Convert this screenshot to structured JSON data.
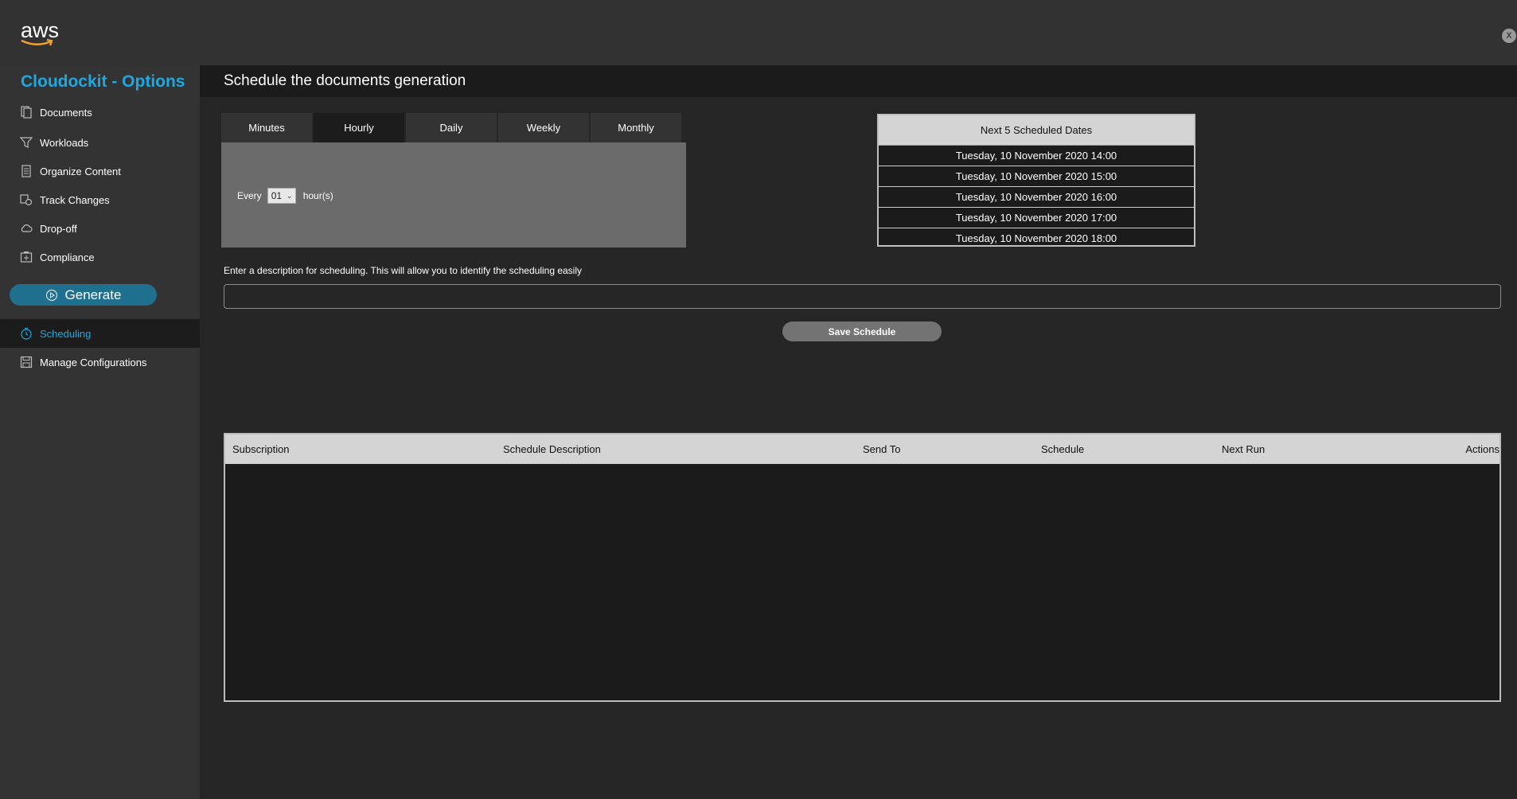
{
  "topbar": {
    "logo": "aws",
    "close_label": "x"
  },
  "sidebar": {
    "title": "Cloudockit - Options",
    "items": [
      {
        "label": "Documents",
        "icon": "documents-icon"
      },
      {
        "label": "Workloads",
        "icon": "filter-icon"
      },
      {
        "label": "Organize Content",
        "icon": "organize-icon"
      },
      {
        "label": "Track Changes",
        "icon": "track-changes-icon"
      },
      {
        "label": "Drop-off",
        "icon": "cloud-icon"
      },
      {
        "label": "Compliance",
        "icon": "compliance-icon"
      }
    ],
    "generate_label": "Generate",
    "bottom_items": [
      {
        "label": "Scheduling",
        "icon": "clock-icon",
        "active": true
      },
      {
        "label": "Manage Configurations",
        "icon": "save-icon"
      }
    ],
    "accent": "#1fa8e0"
  },
  "page": {
    "title": "Schedule the documents generation"
  },
  "tabs": [
    {
      "label": "Minutes",
      "active": false
    },
    {
      "label": "Hourly",
      "active": true
    },
    {
      "label": "Daily",
      "active": false
    },
    {
      "label": "Weekly",
      "active": false
    },
    {
      "label": "Monthly",
      "active": false
    }
  ],
  "hourly": {
    "every_label": "Every",
    "value": "01",
    "unit": "hour(s)"
  },
  "next_dates": {
    "header": "Next 5 Scheduled Dates",
    "rows": [
      "Tuesday, 10 November 2020 14:00",
      "Tuesday, 10 November 2020 15:00",
      "Tuesday, 10 November 2020 16:00",
      "Tuesday, 10 November 2020 17:00",
      "Tuesday, 10 November 2020 18:00"
    ]
  },
  "description": {
    "label": "Enter a description for scheduling. This will allow you to identify the scheduling easily",
    "value": "",
    "placeholder": ""
  },
  "save_label": "Save Schedule",
  "subscriptions": {
    "columns": [
      "Subscription",
      "Schedule Description",
      "Send To",
      "Schedule",
      "Next Run",
      "Actions"
    ],
    "rows": []
  }
}
